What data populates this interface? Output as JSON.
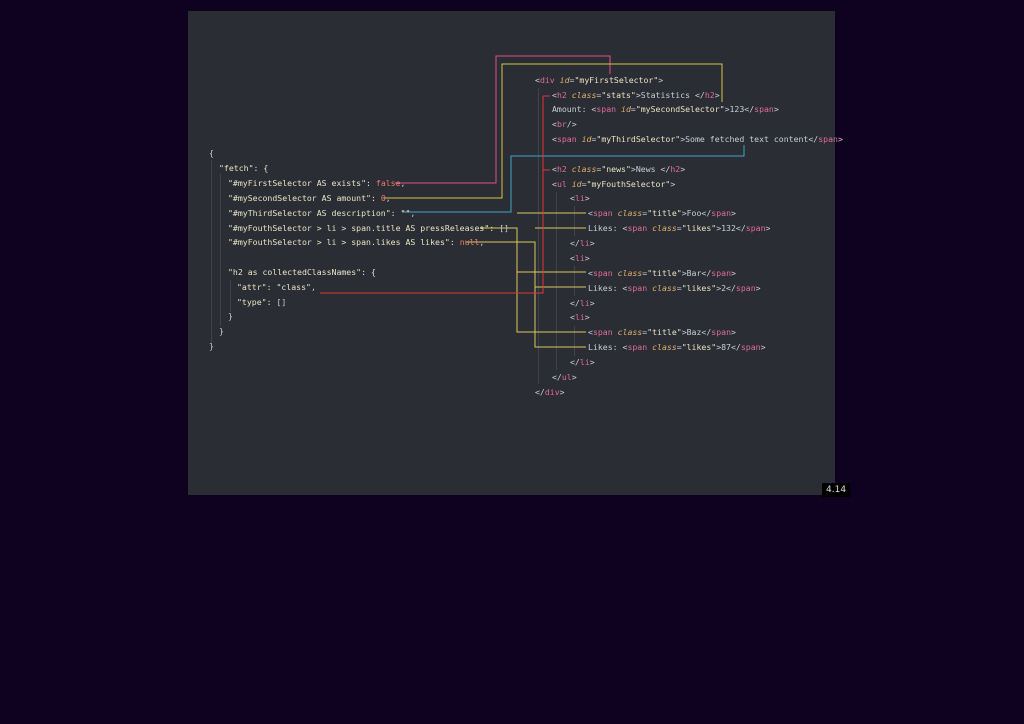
{
  "slide_number": "4.14",
  "colors": {
    "background": "#0f0220",
    "slide": "#2a2d33",
    "wire_pink": "#e0508a",
    "wire_yellow": "#d8c24a",
    "wire_blue": "#3fa7c8",
    "wire_red": "#e0353a",
    "wire_gold": "#d9c95e"
  },
  "left": {
    "l1": "{",
    "l2": "\"fetch\": {",
    "l3k": "\"#myFirstSelector AS exists\": ",
    "l3v": "false",
    "l3c": ",",
    "l4k": "\"#mySecondSelector AS amount\": ",
    "l4v": "0",
    "l4c": ",",
    "l5k": "\"#myThirdSelector AS description\": ",
    "l5v": "\"\"",
    "l5c": ",",
    "l6k": "\"#myFouthSelector > li > span.title AS pressReleases\": ",
    "l6v": "[]",
    "l7k": "\"#myFouthSelector > li > span.likes AS likes\": ",
    "l7v": "null",
    "l7c": ",",
    "l8": "\"h2 as collectedClassNames\": {",
    "l9k": "\"attr\": ",
    "l9v": "\"class\"",
    "l9c": ",",
    "l10k": "\"type\": ",
    "l10v": "[]",
    "l11": "}",
    "l12": "}",
    "l13": "}"
  },
  "right": {
    "r1": [
      "<",
      "div",
      " ",
      "id",
      "=",
      "\"myFirstSelector\"",
      ">"
    ],
    "r2": [
      "<",
      "h2",
      " ",
      "class",
      "=",
      "\"stats\"",
      ">Statistics </",
      "h2",
      ">"
    ],
    "r3": [
      "Amount: <",
      "span",
      " ",
      "id",
      "=",
      "\"mySecondSelector\"",
      ">123</",
      "span",
      ">"
    ],
    "r4": [
      "<",
      "br",
      "/>"
    ],
    "r5": [
      "<",
      "span",
      " ",
      "id",
      "=",
      "\"myThirdSelector\"",
      ">Some fetched text content</",
      "span",
      ">"
    ],
    "r6": [
      "<",
      "h2",
      " ",
      "class",
      "=",
      "\"news\"",
      ">News </",
      "h2",
      ">"
    ],
    "r7": [
      "<",
      "ul",
      " ",
      "id",
      "=",
      "\"myFouthSelector\"",
      ">"
    ],
    "r8": [
      "<",
      "li",
      ">"
    ],
    "r9": [
      "<",
      "span",
      " ",
      "class",
      "=",
      "\"title\"",
      ">Foo</",
      "span",
      ">"
    ],
    "r10": [
      "Likes: <",
      "span",
      " ",
      "class",
      "=",
      "\"likes\"",
      ">132</",
      "span",
      ">"
    ],
    "r11": [
      "</",
      "li",
      ">"
    ],
    "r12": [
      "<",
      "li",
      ">"
    ],
    "r13": [
      "<",
      "span",
      " ",
      "class",
      "=",
      "\"title\"",
      ">Bar</",
      "span",
      ">"
    ],
    "r14": [
      "Likes: <",
      "span",
      " ",
      "class",
      "=",
      "\"likes\"",
      ">2</",
      "span",
      ">"
    ],
    "r15": [
      "</",
      "li",
      ">"
    ],
    "r16": [
      "<",
      "li",
      ">"
    ],
    "r17": [
      "<",
      "span",
      " ",
      "class",
      "=",
      "\"title\"",
      ">Baz</",
      "span",
      ">"
    ],
    "r18": [
      "Likes: <",
      "span",
      " ",
      "class",
      "=",
      "\"likes\"",
      ">87</",
      "span",
      ">"
    ],
    "r19": [
      "</",
      "li",
      ">"
    ],
    "r20": [
      "</",
      "ul",
      ">"
    ],
    "r21": [
      "</",
      "div",
      ">"
    ]
  }
}
